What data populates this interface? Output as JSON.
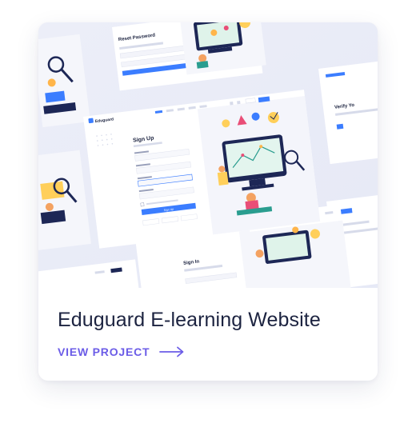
{
  "card": {
    "title": "Eduguard E-learning Website",
    "cta_label": "VIEW PROJECT",
    "accent_color": "#6b5ce7",
    "icons": [
      "arrow-right-icon"
    ]
  },
  "mockups": {
    "brand": "Eduguard",
    "signup": {
      "heading": "Sign Up",
      "button_label": "Sign Up"
    },
    "reset": {
      "heading": "Reset Password"
    },
    "signin": {
      "heading": "Sign In"
    },
    "verify": {
      "heading": "Verify Yo"
    }
  }
}
